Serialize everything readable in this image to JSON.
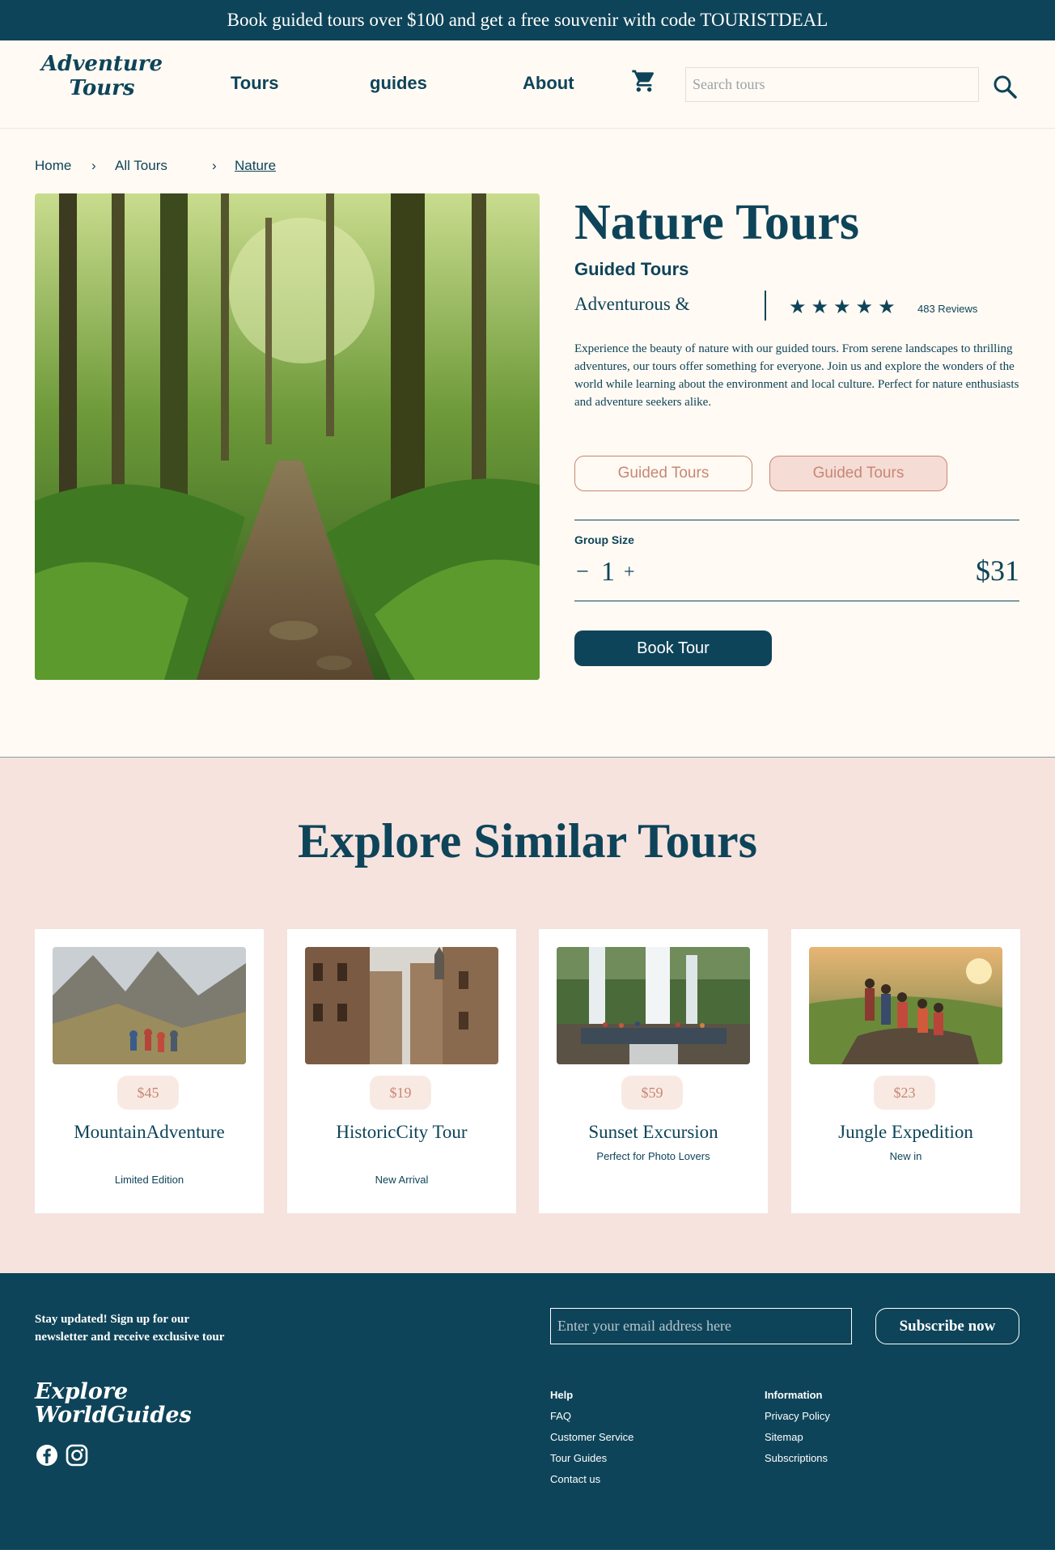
{
  "promo": {
    "text": "Book guided tours over $100 and get a free souvenir with code TOURISTDEAL"
  },
  "header": {
    "logo_line1": "Adventure",
    "logo_line2": "Tours",
    "nav": {
      "tours": "Tours",
      "guides": "guides",
      "about": "About"
    },
    "search_placeholder": "Search tours"
  },
  "breadcrumb": {
    "home": "Home",
    "sep1": "›",
    "all_tours": "All Tours",
    "sep2": "›",
    "current": "Nature"
  },
  "product": {
    "title": "Nature Tours",
    "subtitle": "Guided Tours",
    "tagline": "Adventurous &",
    "rating": 5,
    "stars": "★★★★★",
    "reviews": "483 Reviews",
    "description": "Experience the beauty of nature with our guided tours. From serene landscapes to thrilling adventures, our tours offer something for everyone. Join us and explore the wonders of the world while learning about the environment and local culture. Perfect for nature enthusiasts and adventure seekers alike.",
    "options": [
      "Guided Tours",
      "Guided Tours"
    ],
    "group_size_label": "Group Size",
    "minus": "−",
    "quantity": "1",
    "plus": "+",
    "price": "$31",
    "book_label": "Book Tour"
  },
  "similar": {
    "title": "Explore Similar Tours",
    "cards": [
      {
        "price": "$45",
        "name": "MountainAdventure",
        "note": "Limited Edition"
      },
      {
        "price": "$19",
        "name": "HistoricCity Tour",
        "note": "New Arrival"
      },
      {
        "price": "$59",
        "name": "Sunset Excursion",
        "note": "Perfect for Photo Lovers"
      },
      {
        "price": "$23",
        "name": "Jungle Expedition",
        "note": "New in"
      }
    ]
  },
  "footer": {
    "newsletter_text": "Stay updated! Sign up for our newsletter and receive exclusive tour",
    "email_placeholder": "Enter your email address here",
    "subscribe_label": "Subscribe now",
    "logo_line1": "Explore",
    "logo_line2": "WorldGuides",
    "help": {
      "heading": "Help",
      "links": [
        "FAQ",
        "Customer Service",
        "Tour Guides",
        "Contact us"
      ]
    },
    "information": {
      "heading": "Information",
      "links": [
        "Privacy Policy",
        "Sitemap",
        "Subscriptions"
      ]
    }
  },
  "colors": {
    "primary": "#0e4459",
    "accent": "#c98675",
    "section_bg": "#f6e3de",
    "page_bg": "#fffaf3"
  },
  "icons": [
    "cart-icon",
    "search-icon",
    "facebook-icon",
    "instagram-icon"
  ]
}
